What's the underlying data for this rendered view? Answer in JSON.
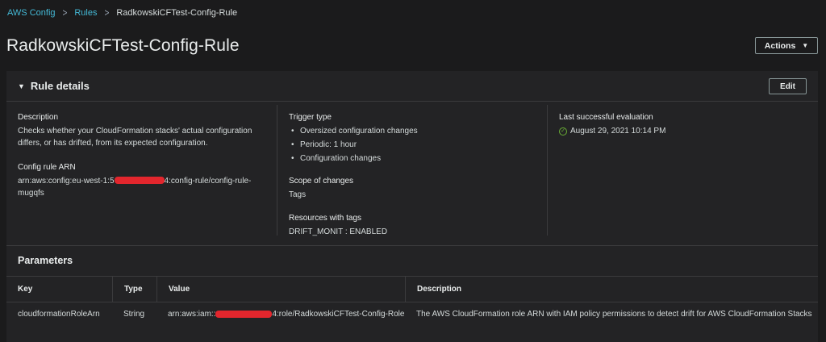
{
  "breadcrumb": {
    "root": "AWS Config",
    "rules": "Rules",
    "current": "RadkowskiCFTest-Config-Rule"
  },
  "header": {
    "title": "RadkowskiCFTest-Config-Rule",
    "actions_label": "Actions"
  },
  "rule_details": {
    "title": "Rule details",
    "edit_label": "Edit",
    "description_label": "Description",
    "description_value": "Checks whether your CloudFormation stacks' actual configuration differs, or has drifted, from its expected configuration.",
    "arn_label": "Config rule ARN",
    "arn_prefix": "arn:aws:config:eu-west-1:5",
    "arn_suffix_1": "4:config-rule/config-rule-",
    "arn_suffix_2": "mugqfs",
    "trigger_label": "Trigger type",
    "triggers": [
      "Oversized configuration changes",
      "Periodic: 1 hour",
      "Configuration changes"
    ],
    "scope_label": "Scope of changes",
    "scope_value": "Tags",
    "resources_label": "Resources with tags",
    "resources_value": "DRIFT_MONIT : ENABLED",
    "last_eval_label": "Last successful evaluation",
    "last_eval_value": "August 29, 2021 10:14 PM"
  },
  "parameters": {
    "title": "Parameters",
    "columns": [
      "Key",
      "Type",
      "Value",
      "Description"
    ],
    "rows": [
      {
        "key": "cloudformationRoleArn",
        "type": "String",
        "value_prefix": "arn:aws:iam::",
        "value_suffix": "4:role/RadkowskiCFTest-Config-Role",
        "description": "The AWS CloudFormation role ARN with IAM policy permissions to detect drift for AWS CloudFormation Stacks"
      }
    ]
  },
  "colors": {
    "background": "#1b1b1c",
    "panel": "#232325",
    "link": "#44b9d6",
    "success": "#6aaf35",
    "redaction": "#e3262d"
  },
  "icons": {
    "breadcrumb_separator": "chevron-right-icon",
    "actions_caret": "caret-down-icon",
    "panel_toggle": "caret-down-icon",
    "status": "check-circle-icon"
  }
}
